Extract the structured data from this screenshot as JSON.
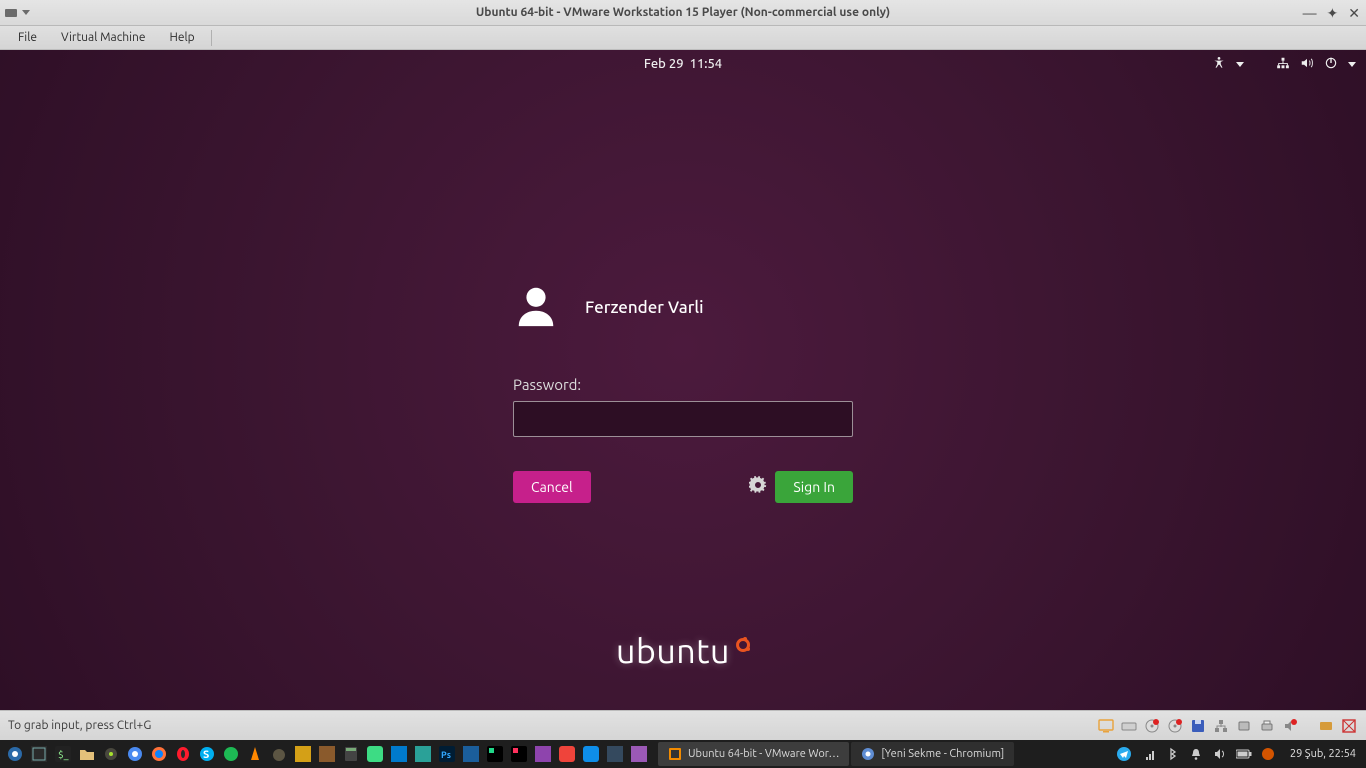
{
  "vmware": {
    "title": "Ubuntu 64-bit - VMware Workstation 15 Player (Non-commercial use only)",
    "menu": {
      "file": "File",
      "vm": "Virtual Machine",
      "help": "Help"
    },
    "footer_hint": "To grab input, press Ctrl+G"
  },
  "ubuntu": {
    "date": "Feb 29",
    "time": "11:54",
    "user_name": "Ferzender Varli",
    "password_label": "Password:",
    "password_value": "",
    "cancel_label": "Cancel",
    "signin_label": "Sign In",
    "logo_text": "ubuntu",
    "colors": {
      "accent_pink": "#c6208b",
      "accent_green": "#3aa53a",
      "accent_orange": "#e95420",
      "background": "#3b1530"
    }
  },
  "host": {
    "task_vmware": "Ubuntu 64-bit - VMware Wor…",
    "task_chromium": "[Yeni Sekme - Chromium]",
    "clock": "29 Şub, 22:54"
  }
}
